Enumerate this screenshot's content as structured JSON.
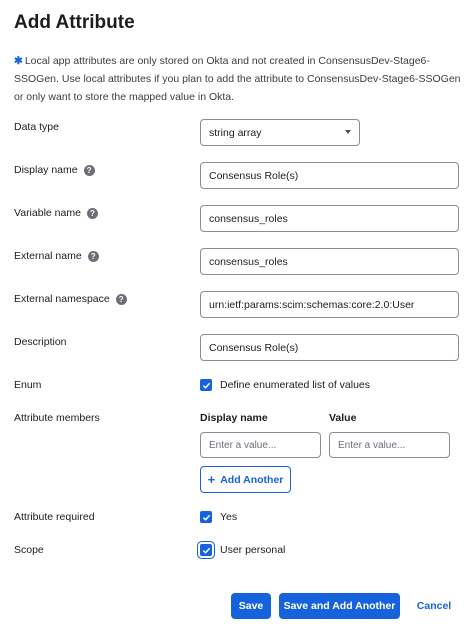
{
  "header": {
    "title": "Add Attribute"
  },
  "notice": {
    "text": "Local app attributes are only stored on Okta and not created in ConsensusDev-Stage6-SSOGen. Use local attributes if you plan to add the attribute to ConsensusDev-Stage6-SSOGen or only want to store the mapped value in Okta."
  },
  "form": {
    "data_type": {
      "label": "Data type",
      "value": "string array"
    },
    "display_name": {
      "label": "Display name",
      "value": "Consensus Role(s)"
    },
    "variable_name": {
      "label": "Variable name",
      "value": "consensus_roles"
    },
    "external_name": {
      "label": "External name",
      "value": "consensus_roles"
    },
    "external_namespace": {
      "label": "External namespace",
      "value": "urn:ietf:params:scim:schemas:core:2.0:User"
    },
    "description": {
      "label": "Description",
      "value": "Consensus Role(s)"
    },
    "enum": {
      "label": "Enum",
      "checkbox_label": "Define enumerated list of values",
      "checked": true
    },
    "attribute_members": {
      "label": "Attribute members",
      "col_display_name": "Display name",
      "col_value": "Value",
      "display_placeholder": "Enter a value...",
      "value_placeholder": "Enter a value...",
      "add_another_label": "Add Another"
    },
    "attribute_required": {
      "label": "Attribute required",
      "checkbox_label": "Yes",
      "checked": true
    },
    "scope": {
      "label": "Scope",
      "checkbox_label": "User personal",
      "checked": true
    }
  },
  "footer": {
    "save_label": "Save",
    "save_add_label": "Save and Add Another",
    "cancel_label": "Cancel"
  },
  "colors": {
    "accent": "#1662dd",
    "help_icon": "#6e6e78"
  }
}
